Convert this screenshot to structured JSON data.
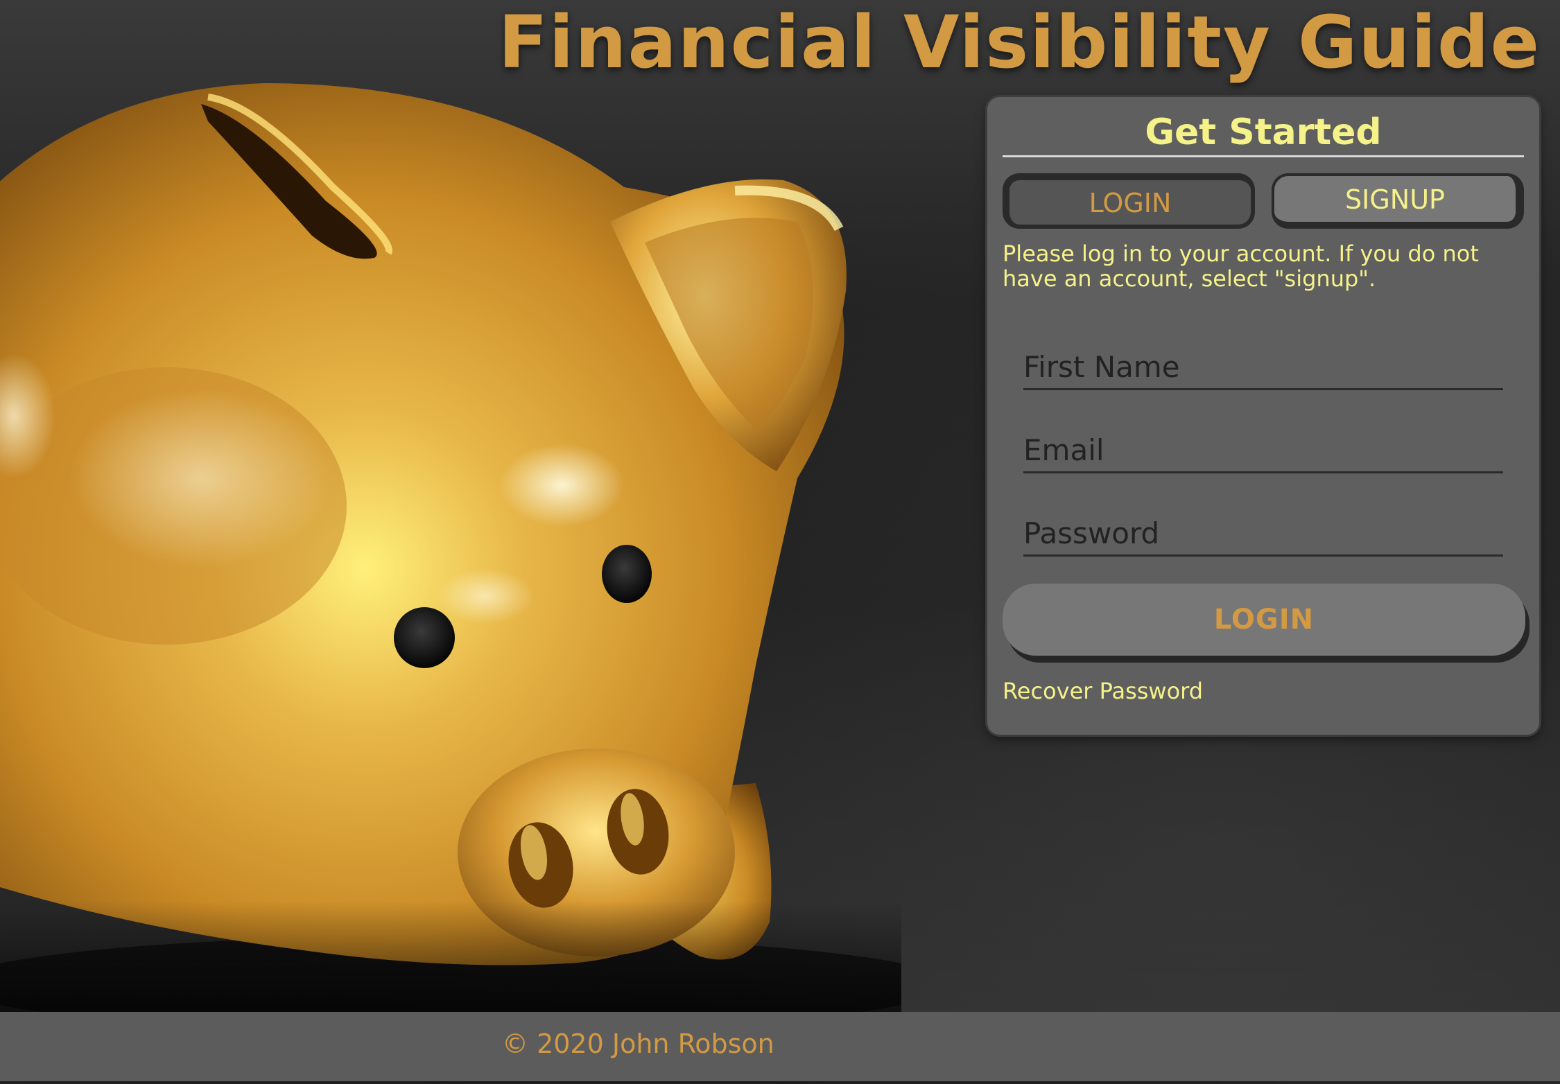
{
  "header": {
    "title": "Financial Visibility Guide"
  },
  "hero": {
    "image": "golden-piggy-bank"
  },
  "panel": {
    "title": "Get Started",
    "tabs": {
      "login_label": "LOGIN",
      "signup_label": "SIGNUP"
    },
    "instructions": "Please log in to your account. If you do not have an account, select \"signup\".",
    "fields": {
      "first_name_placeholder": "First Name",
      "email_placeholder": "Email",
      "password_placeholder": "Password"
    },
    "submit_label": "LOGIN",
    "recover_label": "Recover Password"
  },
  "footer": {
    "copyright": "© 2020 John Robson"
  },
  "colors": {
    "accent_gold": "#d39a44",
    "accent_yellow": "#f6f28a",
    "panel_bg": "#5f5f5f",
    "footer_bg": "#5c5c5c"
  }
}
